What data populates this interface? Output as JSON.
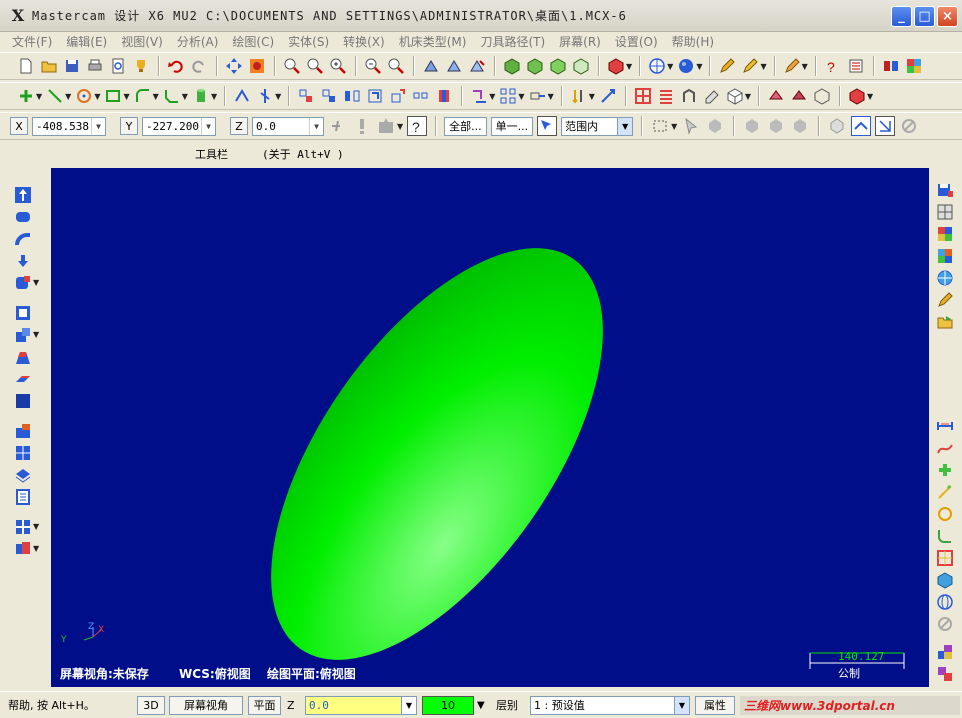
{
  "window": {
    "logo": "X",
    "title": "Mastercam 设计  X6 MU2  C:\\DOCUMENTS AND SETTINGS\\ADMINISTRATOR\\桌面\\1.MCX-6",
    "minimize": "_",
    "maximize": "□",
    "close": "×"
  },
  "menu": [
    "文件(F)",
    "编辑(E)",
    "视图(V)",
    "分析(A)",
    "绘图(C)",
    "实体(S)",
    "转换(X)",
    "机床类型(M)",
    "刀具路径(T)",
    "屏幕(R)",
    "设置(O)",
    "帮助(H)"
  ],
  "coords": {
    "x_label": "X",
    "x_value": "-408.538",
    "y_label": "Y",
    "y_value": "-227.200",
    "z_label": "Z",
    "z_value": "0.0",
    "all_button": "全部...",
    "single_button": "单一...",
    "range_select": "范围内"
  },
  "hints": {
    "toolbar": "工具栏",
    "about": "(关于 Alt+V )"
  },
  "viewport": {
    "background_color": "#000e8a",
    "shape_color": "#00ee00",
    "screen_view": "屏幕视角:未保存",
    "wcs": "WCS:俯视图",
    "cplane": "绘图平面:俯视图",
    "scale_value": "140.127",
    "scale_unit": "公制",
    "axis_x": "X",
    "axis_y": "Y",
    "axis_z": "Z"
  },
  "status": {
    "help": "帮助, 按 Alt+H。",
    "mode_3d": "3D",
    "screen_view_btn": "屏幕视角",
    "plane_btn": "平面",
    "z_label": "Z",
    "z_value": "0.0",
    "color_value": "10",
    "layer_label": "层别",
    "layer_value": "1 : 预设值",
    "attr_btn": "属性",
    "watermark": "三维网www.3dportal.cn"
  }
}
